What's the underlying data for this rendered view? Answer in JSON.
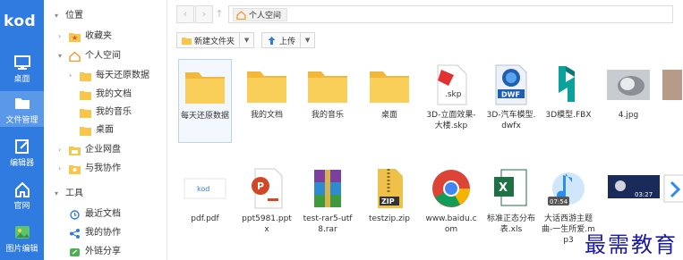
{
  "app": {
    "logo": "kod"
  },
  "rail": [
    {
      "id": "desktop",
      "label": "桌面",
      "icon": "monitor-icon"
    },
    {
      "id": "files",
      "label": "文件管理",
      "icon": "folder-icon",
      "active": true
    },
    {
      "id": "editor",
      "label": "编辑器",
      "icon": "edit-icon"
    },
    {
      "id": "website",
      "label": "官网",
      "icon": "home-icon"
    },
    {
      "id": "image",
      "label": "图片编辑",
      "icon": "image-icon"
    }
  ],
  "tree": {
    "location": "位置",
    "favorites": "收藏夹",
    "personal": "个人空间",
    "children": [
      "每天还原数据",
      "我的文档",
      "我的音乐",
      "桌面"
    ],
    "enterprise": "企业网盘",
    "shared": "与我协作",
    "tools": "工具",
    "recent": "最近文档",
    "collab": "我的协作",
    "link": "外链分享"
  },
  "address": {
    "crumb": "个人空间"
  },
  "toolbar": {
    "new_folder": "新建文件夹",
    "upload": "上传"
  },
  "files": [
    {
      "name": "每天还原数据",
      "type": "folder"
    },
    {
      "name": "我的文档",
      "type": "folder"
    },
    {
      "name": "我的音乐",
      "type": "folder"
    },
    {
      "name": "桌面",
      "type": "folder"
    },
    {
      "name": "3D-立面效果-大楼.skp",
      "type": "skp",
      "badge": ".skp"
    },
    {
      "name": "3D-汽车模型.dwfx",
      "type": "dwfx",
      "badge": "DWF"
    },
    {
      "name": "3D模型.FBX",
      "type": "fbx"
    },
    {
      "name": "4.jpg",
      "type": "jpg"
    },
    {
      "name": "",
      "type": "jpg2"
    },
    {
      "name": "pdf.pdf",
      "type": "pdf",
      "badge": "kod"
    },
    {
      "name": "ppt5981.pptx",
      "type": "pptx"
    },
    {
      "name": "test-rar5-utf8.rar",
      "type": "rar"
    },
    {
      "name": "testzip.zip",
      "type": "zip",
      "badge": "ZIP"
    },
    {
      "name": "www.baidu.com",
      "type": "chrome"
    },
    {
      "name": "标准正态分布表.xls",
      "type": "xls"
    },
    {
      "name": "大话西游主题曲-一生所爱.mp3",
      "type": "mp3",
      "badge": "07:54"
    },
    {
      "name": "",
      "type": "video",
      "badge": "03:27"
    },
    {
      "name": "",
      "type": "partial"
    }
  ],
  "colors": {
    "rail": "#2f7be0",
    "folder": "#f9c54a",
    "accent": "#2f7be0"
  },
  "watermark": "最需教育"
}
